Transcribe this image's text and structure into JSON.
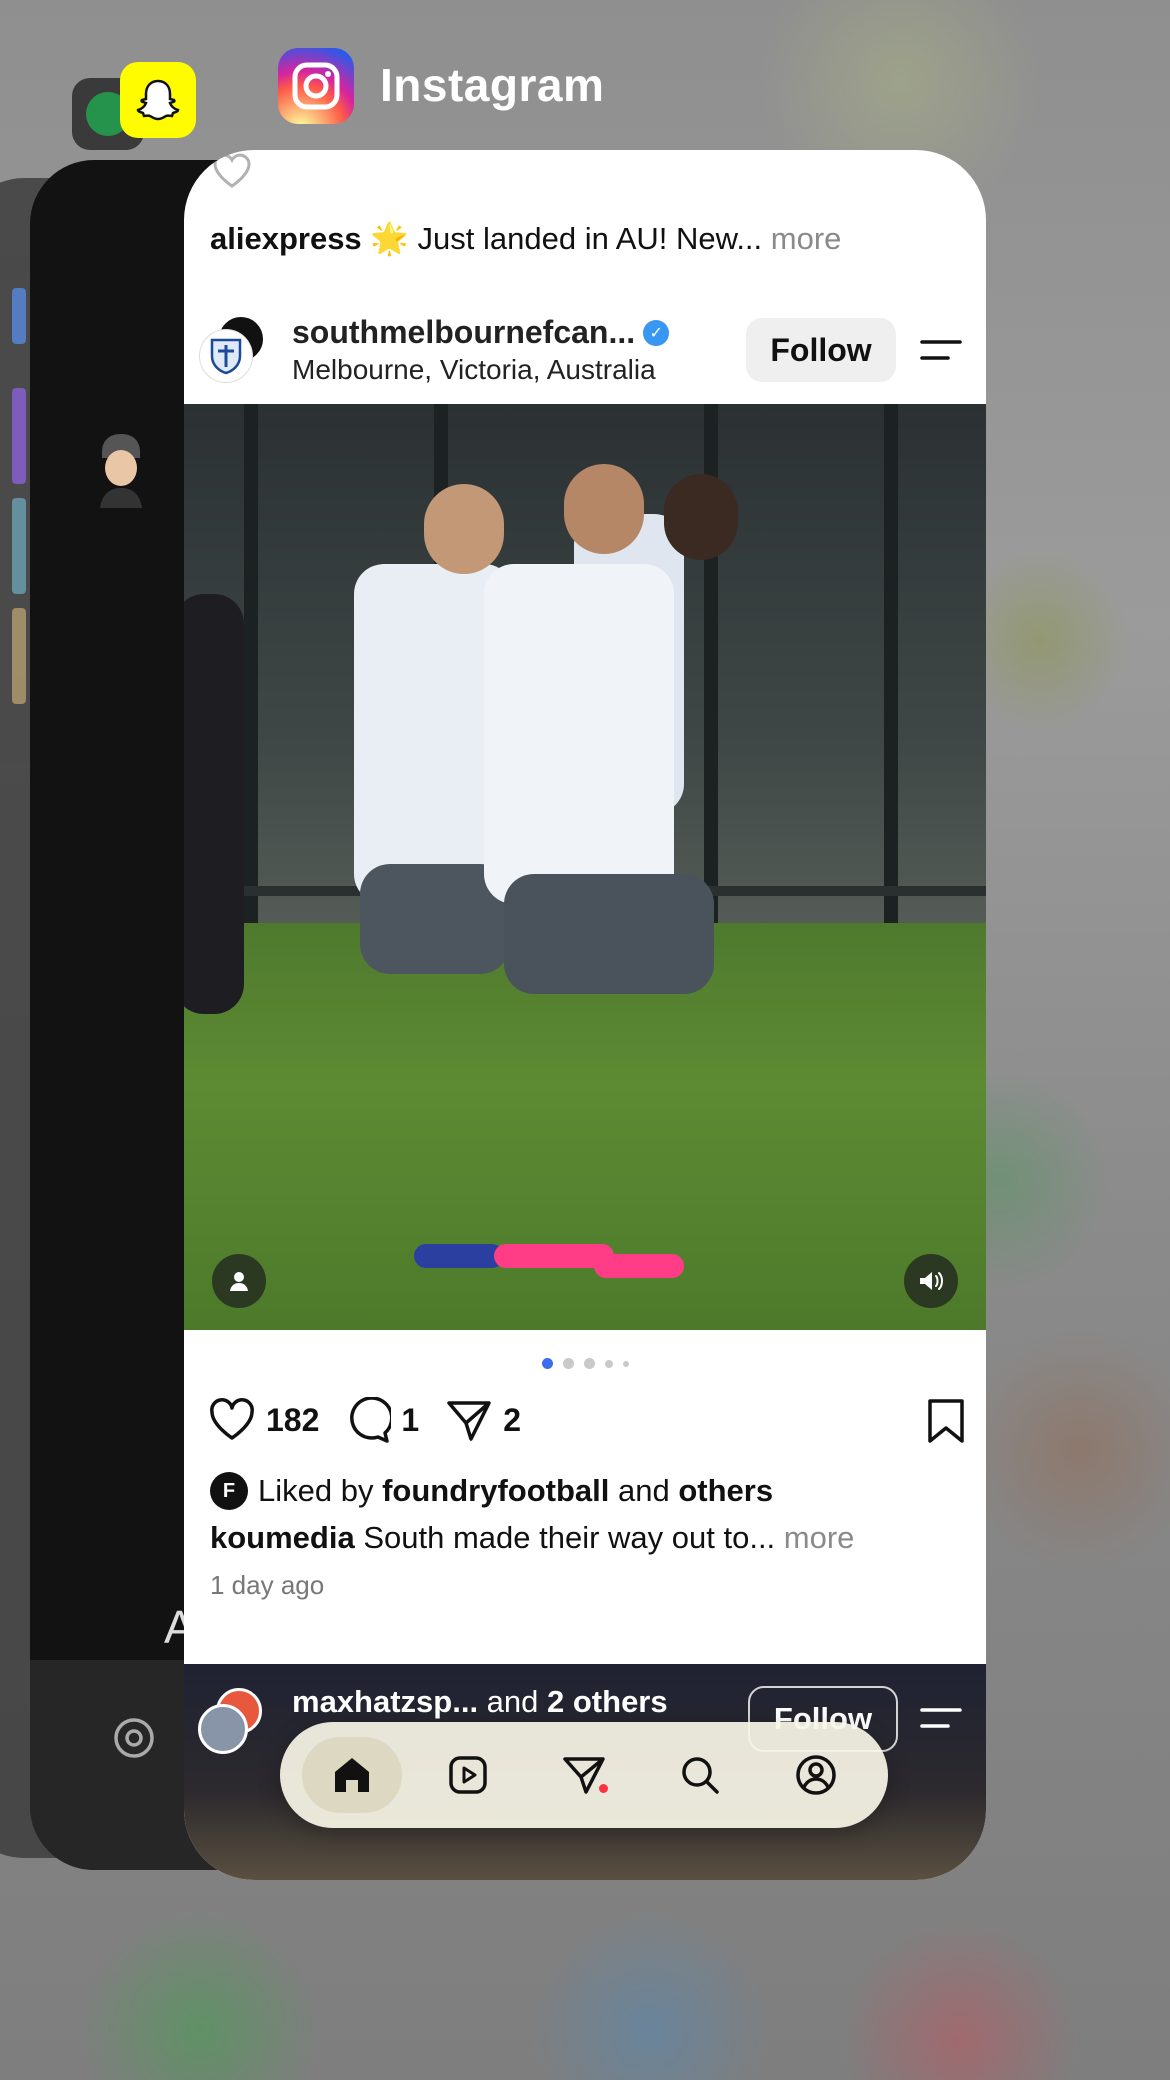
{
  "switcher": {
    "app_title": "Instagram",
    "background_apps": [
      "spotify-icon",
      "snapchat-icon"
    ]
  },
  "snap_card": {
    "ai_label": "Ai"
  },
  "instagram": {
    "previous_post": {
      "caption_user": "aliexpress",
      "caption_emoji": "🌟",
      "caption_text": " Just landed in AU! New...",
      "more_label": " more"
    },
    "post": {
      "username": "southmelbournefc",
      "username_suffix": " an...",
      "location": "Melbourne, Victoria, Australia",
      "follow_label": "Follow",
      "likes": "182",
      "comments": "1",
      "shares": "2",
      "liked_by_prefix": "Liked by ",
      "liked_by_user": "foundryfootball",
      "liked_by_middle": " and ",
      "liked_by_others": "others",
      "caption_user": "koumedia",
      "caption_text": " South made their way out to...",
      "more_label": " more",
      "time_ago": "1 day ago",
      "carousel_count": 5,
      "carousel_active": 1
    },
    "next_post": {
      "username": "maxhatzsp...",
      "and_label": " and ",
      "others_label": "2 others",
      "follow_label": "Follow"
    },
    "tabbar": {
      "items": [
        "home-icon",
        "reels-icon",
        "messages-icon",
        "search-icon",
        "profile-icon"
      ],
      "active": "home-icon"
    }
  },
  "colors": {
    "ig_accent": "#3897f0",
    "notification": "#ff3040",
    "snap_yellow": "#fffc00"
  }
}
